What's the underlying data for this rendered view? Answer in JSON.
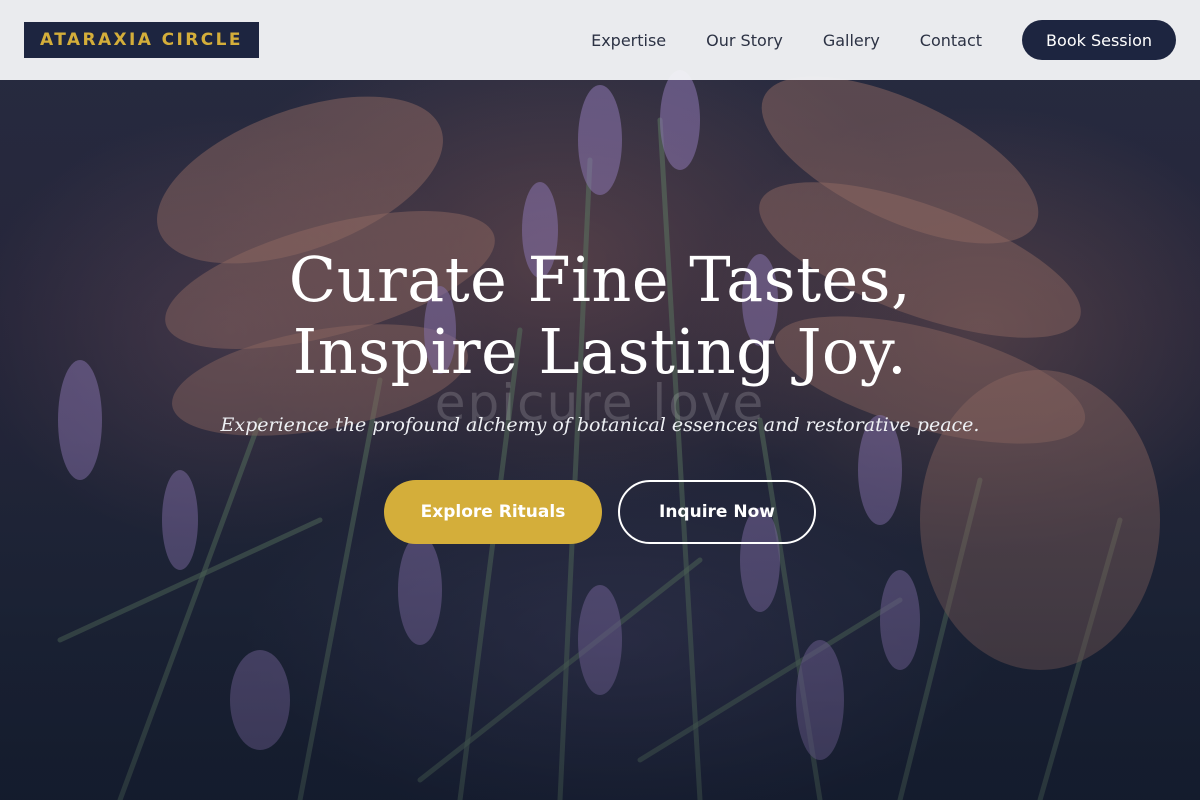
{
  "brand": {
    "logo_text": "ATARAXIA CIRCLE"
  },
  "nav": {
    "links": [
      "Expertise",
      "Our Story",
      "Gallery",
      "Contact"
    ],
    "cta_label": "Book Session"
  },
  "hero": {
    "title": "Curate Fine Tastes, Inspire Lasting Joy.",
    "ghost_text": "epicure love",
    "subtitle": "Experience the profound alchemy of botanical essences and restorative peace.",
    "primary_button": "Explore Rituals",
    "secondary_button": "Inquire Now",
    "background_image": "hands-holding-lavender-photo"
  },
  "colors": {
    "brand_navy": "#1d2540",
    "brand_gold": "#d4ae3a",
    "header_bg": "#f4f5f8",
    "text_light": "#ffffff"
  }
}
